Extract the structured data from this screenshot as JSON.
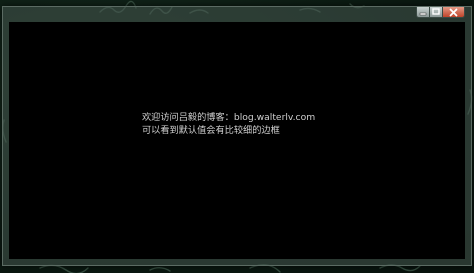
{
  "window": {
    "caption_buttons": [
      {
        "name": "minimize",
        "icon": "minimize-icon"
      },
      {
        "name": "maximize",
        "icon": "maximize-icon"
      },
      {
        "name": "close",
        "icon": "close-icon",
        "color": "#c0442a"
      }
    ]
  },
  "content": {
    "line1": "欢迎访问吕毅的博客：blog.walterlv.com",
    "line2": "可以看到默认值会有比较细的边框"
  },
  "colors": {
    "client_background": "#000000",
    "text": "#d0d0d0",
    "desktop": "#0d1f16"
  }
}
